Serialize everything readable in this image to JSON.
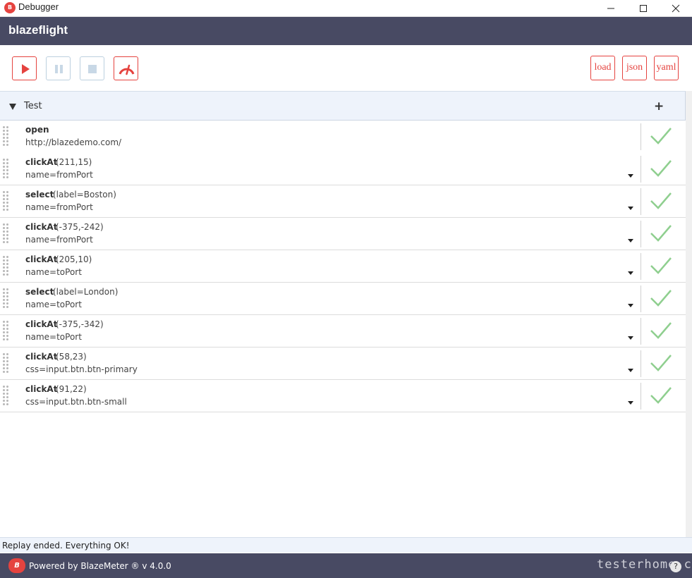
{
  "window": {
    "title": "Debugger"
  },
  "app": {
    "brand": "blazeflight"
  },
  "toolbar": {
    "load": "load",
    "json": "json",
    "yaml": "yaml"
  },
  "test": {
    "name": "Test",
    "add_symbol": "+"
  },
  "commands": [
    {
      "name": "open",
      "value": "",
      "target": "http://blazedemo.com/",
      "status": "passed"
    },
    {
      "name": "clickAt",
      "value": "(211,15)",
      "target": "name=fromPort",
      "status": "passed"
    },
    {
      "name": "select",
      "value": "(label=Boston)",
      "target": "name=fromPort",
      "status": "passed"
    },
    {
      "name": "clickAt",
      "value": "(-375,-242)",
      "target": "name=fromPort",
      "status": "passed"
    },
    {
      "name": "clickAt",
      "value": "(205,10)",
      "target": "name=toPort",
      "status": "passed"
    },
    {
      "name": "select",
      "value": "(label=London)",
      "target": "name=toPort",
      "status": "passed"
    },
    {
      "name": "clickAt",
      "value": "(-375,-342)",
      "target": "name=toPort",
      "status": "passed"
    },
    {
      "name": "clickAt",
      "value": "(58,23)",
      "target": "css=input.btn.btn-primary",
      "status": "passed"
    },
    {
      "name": "clickAt",
      "value": "(91,22)",
      "target": "css=input.btn.btn-small",
      "status": "passed"
    }
  ],
  "status": {
    "message": "Replay ended. Everything OK!"
  },
  "footer": {
    "logo_text": "B",
    "powered": "Powered by BlazeMeter ® v 4.0.0",
    "watermark": "testerhome.com",
    "help": "?"
  },
  "colors": {
    "accent": "#e5433f",
    "header_bg": "#484a63",
    "pass_check": "#8fcf8f",
    "disabled_border": "#bcd0df"
  }
}
